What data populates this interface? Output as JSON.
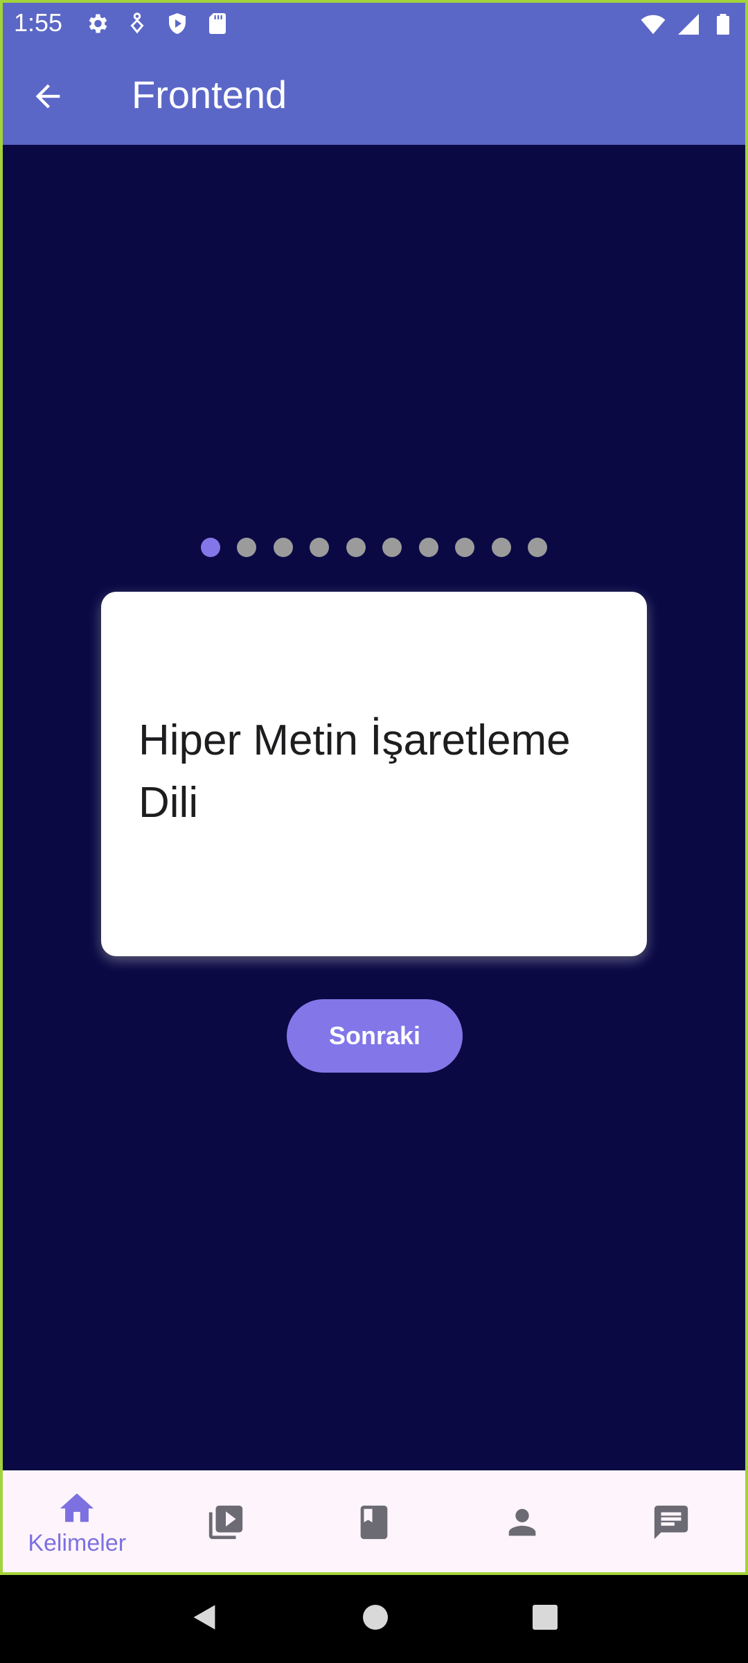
{
  "status_bar": {
    "time": "1:55",
    "icons": [
      "settings-icon",
      "accessibility-icon",
      "shield-play-icon",
      "sd-card-icon",
      "wifi-icon",
      "signal-icon",
      "battery-icon"
    ]
  },
  "toolbar": {
    "title": "Frontend",
    "back_icon": "arrow-back-icon",
    "background_color": "#5b67c7"
  },
  "pager": {
    "total_pages": 10,
    "current_page": 1,
    "active_color": "#8276e8",
    "inactive_color": "#9b9b9b"
  },
  "card": {
    "text": "Hiper Metin İşaretleme Dili"
  },
  "next_button": {
    "label": "Sonraki",
    "color": "#8276e8"
  },
  "bottom_nav": {
    "items": [
      {
        "icon": "home-icon",
        "label": "Kelimeler",
        "selected": true
      },
      {
        "icon": "video-library-icon",
        "label": "",
        "selected": false
      },
      {
        "icon": "book-icon",
        "label": "",
        "selected": false
      },
      {
        "icon": "person-icon",
        "label": "",
        "selected": false
      },
      {
        "icon": "chat-icon",
        "label": "",
        "selected": false
      }
    ]
  },
  "colors": {
    "page_background": "#0a0944",
    "bottom_nav_background": "#fdf5fb"
  }
}
